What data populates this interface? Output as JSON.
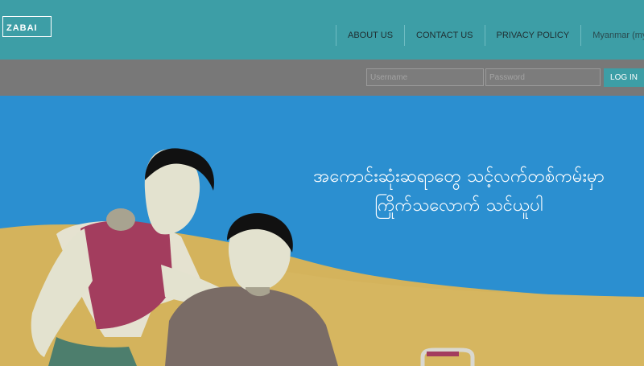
{
  "header": {
    "logo_text": "ZABAI",
    "nav": {
      "about": "ABOUT US",
      "contact": "CONTACT US",
      "privacy": "PRIVACY POLICY",
      "language": "Myanmar (my)"
    }
  },
  "login": {
    "username_placeholder": "Username",
    "password_placeholder": "Password",
    "button_label": "LOG IN"
  },
  "hero": {
    "headline_line1": "အကောင်းဆုံးဆရာတွေ သင့်လက်တစ်ကမ်းမှာ",
    "headline_line2": "ကြိုက်သလောက် သင်ယူပါ"
  },
  "colors": {
    "header_bg": "#3d9ea6",
    "login_bar_bg": "#787878",
    "sky": "#2b8fd0",
    "sand": "#d4b35c"
  }
}
